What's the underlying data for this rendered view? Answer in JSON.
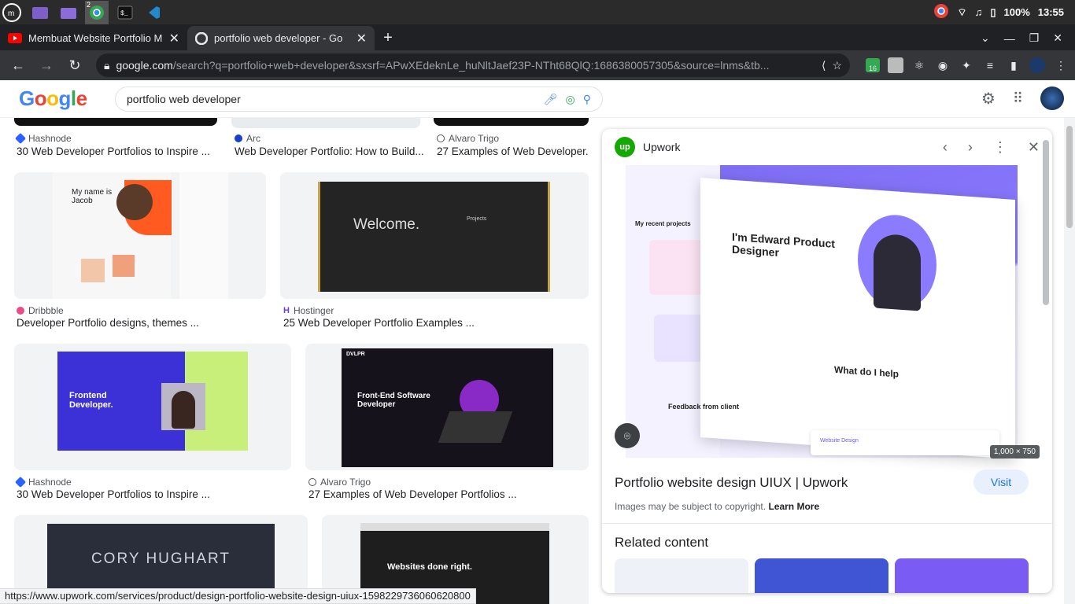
{
  "system": {
    "battery": "100%",
    "time": "13:55",
    "chrome_badge": "2"
  },
  "tabs": [
    {
      "title": "Membuat Website Portfolio M"
    },
    {
      "title": "portfolio web developer - Go"
    }
  ],
  "address": {
    "host": "google.com",
    "path": "/search?q=portfolio+web+developer&sxsrf=APwXEdeknLe_huNltJaef23P-NTht68QlQ:1686380057305&source=lnms&tb...",
    "ext_badge": "16"
  },
  "google": {
    "logo": "Google",
    "query": "portfolio web developer"
  },
  "results": [
    {
      "source": "Hashnode",
      "title": "30 Web Developer Portfolios to Inspire ..."
    },
    {
      "source": "Arc",
      "title": "Web Developer Portfolio: How to Build..."
    },
    {
      "source": "Alvaro Trigo",
      "title": "27 Examples of Web Developer..."
    },
    {
      "source": "Dribbble",
      "title": "Developer Portfolio designs, themes ..."
    },
    {
      "source": "Hostinger",
      "title": "25 Web Developer Portfolio Examples ..."
    },
    {
      "source": "Hashnode",
      "title": "30 Web Developer Portfolios to Inspire ..."
    },
    {
      "source": "Alvaro Trigo",
      "title": "27 Examples of Web Developer Portfolios ..."
    }
  ],
  "thumb_text": {
    "welcome": "Welcome.",
    "projects": "Projects",
    "frontend": "Frontend Developer.",
    "fe_software": "Front-End Software Developer",
    "dvlpr": "DVLPR",
    "cory": "CORY HUGHART",
    "websites": "Websites done right.",
    "myname": "My name is Jacob"
  },
  "panel": {
    "site": "Upwork",
    "site_icon": "up",
    "img": {
      "edward": "I'm Edward Product Designer",
      "recent": "My recent projects",
      "help": "What do I help",
      "feedback": "Feedback from client",
      "web_design": "Website Design"
    },
    "dims": "1,000 × 750",
    "title": "Portfolio website design UIUX | Upwork",
    "visit": "Visit",
    "copyright": "Images may be subject to copyright.",
    "learn_more": "Learn More",
    "related": "Related content"
  },
  "status_url": "https://www.upwork.com/services/product/design-portfolio-website-design-uiux-1598229736060620800"
}
